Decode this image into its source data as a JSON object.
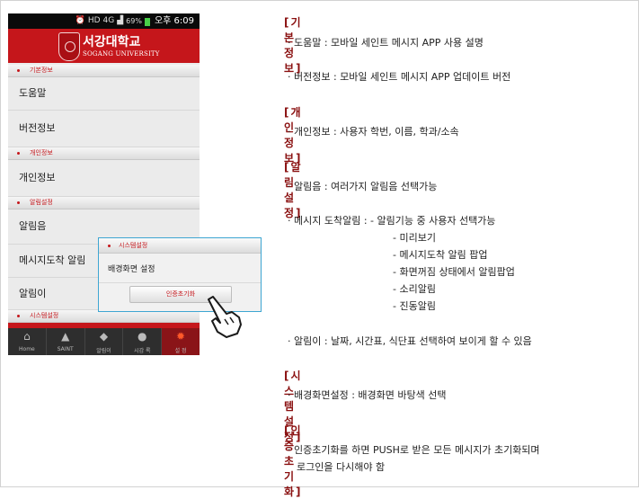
{
  "status_bar": {
    "network": "4G",
    "signal": "69%",
    "time": "오후 6:09"
  },
  "app": {
    "korean_name": "서강대학교",
    "english_name": "SOGANG UNIVERSITY"
  },
  "menu": {
    "sections": [
      {
        "header": "기본정보",
        "items": [
          "도움말",
          "버전정보"
        ]
      },
      {
        "header": "개인정보",
        "items": [
          "개인정보"
        ]
      },
      {
        "header": "알림설정",
        "items": [
          "알림음",
          "메시지도착 알림",
          "알림이"
        ]
      },
      {
        "header": "시스템설정",
        "items": []
      }
    ]
  },
  "popup": {
    "header": "시스템설정",
    "row": "배경화면 설정",
    "button": "인증초기화"
  },
  "tabbar": [
    {
      "icon": "home-icon",
      "label": "Home"
    },
    {
      "icon": "graduation-cap-icon",
      "label": "SAINT"
    },
    {
      "icon": "notification-icon",
      "label": "알림이"
    },
    {
      "icon": "person-icon",
      "label": "시감 록"
    },
    {
      "icon": "gear-icon",
      "label": "설 정"
    }
  ],
  "description": {
    "basic": {
      "title": "[기본정보]",
      "lines": [
        "· 도움말 : 모바일 세인트 메시지 APP 사용 설명",
        "· 버전정보 : 모바일 세인트 메시지 APP 업데이트 버전"
      ]
    },
    "personal": {
      "title": "[개인정보]",
      "lines": [
        "· 개인정보 : 사용자 학번, 이름, 학과/소속"
      ]
    },
    "alarm": {
      "title": "[알림설정]",
      "lines": [
        "· 알림음 : 여러가지 알림음 선택가능",
        "· 메시지 도착알림 : - 알림기능 중 사용자 선택가능",
        "- 미리보기",
        "- 메시지도착 알림 팝업",
        "- 화면꺼짐 상태에서 알림팝업",
        "- 소리알림",
        "- 진동알림",
        "· 알림이 : 날짜, 시간표, 식단표 선택하여 보이게 할 수 있음"
      ]
    },
    "system": {
      "title": "[시스템 설정]",
      "lines": [
        "· 배경화면설정 : 배경화면 바탕색 선택"
      ]
    },
    "reset": {
      "title": "[인증초기화]",
      "lines": [
        "· 인증초기화를 하면 PUSH로 받은 모든 메시지가 초기화되며",
        "로그인을 다시해야 함"
      ]
    }
  }
}
